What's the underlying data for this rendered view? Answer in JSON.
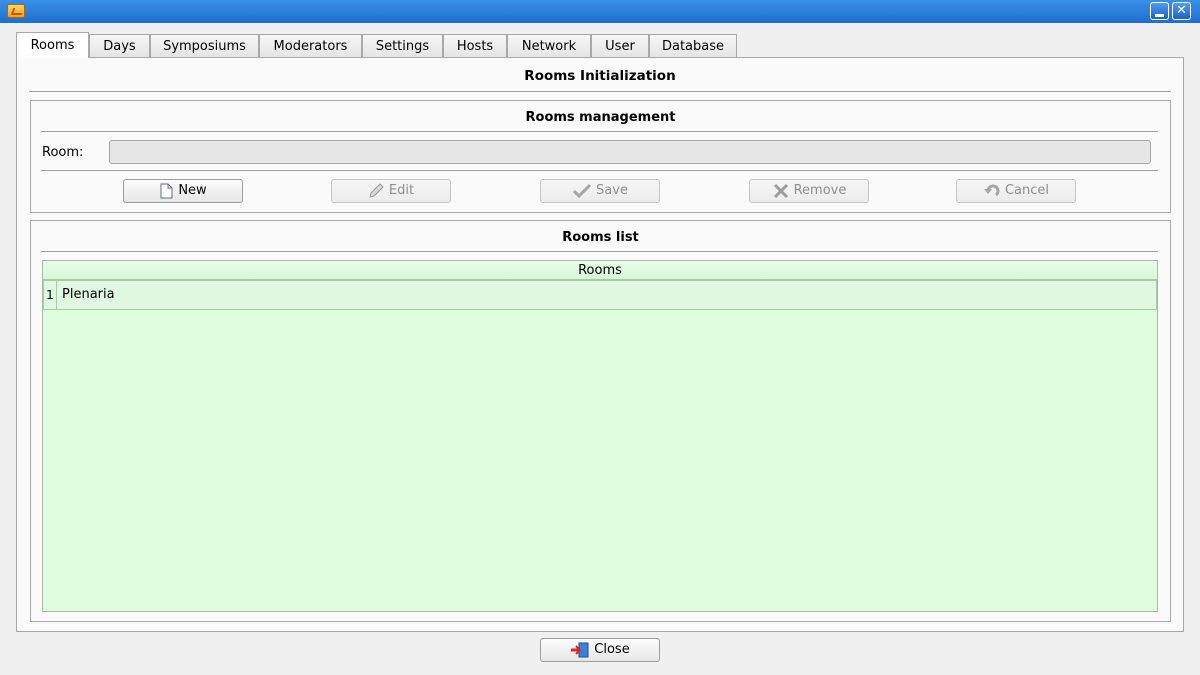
{
  "window": {
    "min_glyph": "",
    "close_glyph": "✕"
  },
  "tabs": [
    {
      "label": "Rooms",
      "active": true
    },
    {
      "label": "Days"
    },
    {
      "label": "Symposiums"
    },
    {
      "label": "Moderators"
    },
    {
      "label": "Settings"
    },
    {
      "label": "Hosts"
    },
    {
      "label": "Network"
    },
    {
      "label": "User"
    },
    {
      "label": "Database"
    }
  ],
  "page": {
    "title": "Rooms Initialization"
  },
  "management": {
    "title": "Rooms management",
    "room_label": "Room:",
    "room_value": "",
    "buttons": {
      "new": "New",
      "edit": "Edit",
      "save": "Save",
      "remove": "Remove",
      "cancel": "Cancel"
    }
  },
  "list": {
    "title": "Rooms list",
    "column": "Rooms",
    "rows": [
      {
        "num": "1",
        "name": "Plenaria"
      }
    ]
  },
  "footer": {
    "close": "Close"
  },
  "colors": {
    "titlebar": "#1f6fcf",
    "grid_bg": "#e0fde0"
  }
}
